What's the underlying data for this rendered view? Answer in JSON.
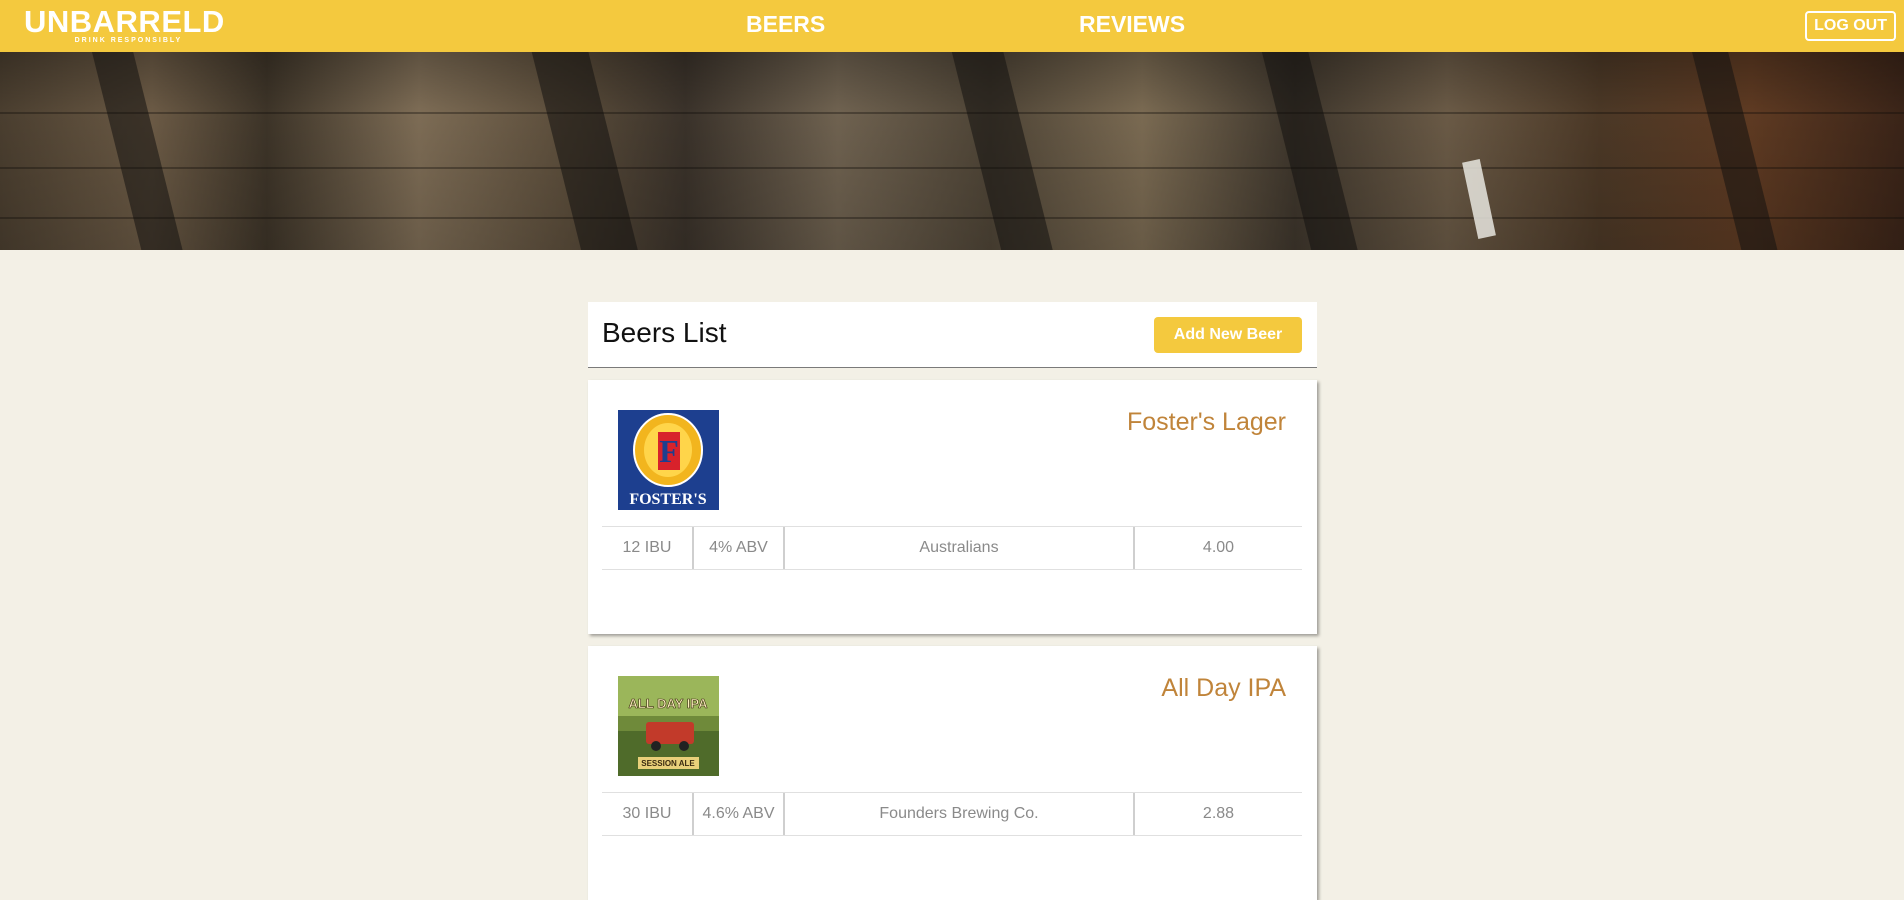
{
  "nav": {
    "logo_title": "UNBARRELD",
    "logo_tagline": "DRINK RESPONSIBLY",
    "beers_label": "BEERS",
    "reviews_label": "REVIEWS",
    "logout_label": "LOG OUT"
  },
  "beers_list": {
    "title": "Beers List",
    "add_button_label": "Add New Beer"
  },
  "beers": [
    {
      "name": "Foster's Lager",
      "image_label": "FOSTER'S",
      "image_letter": "F",
      "ibu": "12 IBU",
      "abv": "4% ABV",
      "brewery": "Australians",
      "rating": "4.00"
    },
    {
      "name": "All Day IPA",
      "image_top": "ALL DAY IPA",
      "image_bottom": "SESSION ALE",
      "ibu": "30 IBU",
      "abv": "4.6% ABV",
      "brewery": "Founders Brewing Co.",
      "rating": "2.88"
    }
  ],
  "colors": {
    "accent": "#f4c93e",
    "page_background": "#f3f0e6",
    "beer_name": "#c0843a",
    "stat_text": "#8a8a8a"
  }
}
